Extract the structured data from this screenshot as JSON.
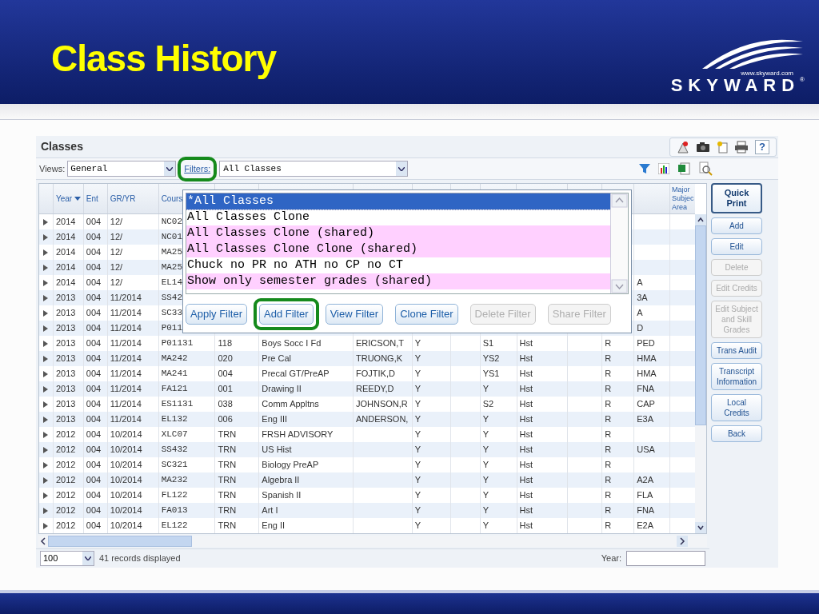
{
  "slide": {
    "title": "Class History",
    "logo": {
      "url": "www.skyward.com",
      "name": "SKYWARD",
      "mark": "®"
    }
  },
  "panel": {
    "title": "Classes",
    "help_label": "?"
  },
  "toolbar": {
    "views_label": "Views:",
    "views_value": "General",
    "filters_link": "Filters:",
    "filters_highlighted": true,
    "filter_value": "All Classes"
  },
  "table": {
    "columns": [
      {
        "label": "Year",
        "sorted": true
      },
      {
        "label": "Ent",
        "sorted": false
      },
      {
        "label": "GR/YR",
        "sorted": false
      },
      {
        "label": "Cours",
        "sorted": false
      }
    ],
    "last_column_heading": [
      "Major",
      "Subjec",
      "Area"
    ],
    "rows": [
      {
        "year": "2014",
        "ent": "004",
        "gr_yr": "12/",
        "course": "NC02"
      },
      {
        "year": "2014",
        "ent": "004",
        "gr_yr": "12/",
        "course": "NC01"
      },
      {
        "year": "2014",
        "ent": "004",
        "gr_yr": "12/",
        "course": "MA25"
      },
      {
        "year": "2014",
        "ent": "004",
        "gr_yr": "12/",
        "course": "MA25"
      },
      {
        "year": "2014",
        "ent": "004",
        "gr_yr": "12/",
        "course": "EL14",
        "column_14": "A"
      },
      {
        "year": "2013",
        "ent": "004",
        "gr_yr": "11/2014",
        "course": "SS42",
        "column_14": "3A"
      },
      {
        "year": "2013",
        "ent": "004",
        "gr_yr": "11/2014",
        "course": "SC33",
        "column_14": "A"
      },
      {
        "year": "2013",
        "ent": "004",
        "gr_yr": "11/2014",
        "course": "P011",
        "column_14": "D"
      },
      {
        "year": "2013",
        "ent": "004",
        "gr_yr": "11/2014",
        "course": "P01131",
        "section": "118",
        "description": "Boys Socc I Fd",
        "teacher": "ERICSON,T",
        "column_8": "Y",
        "column_10": "S1",
        "column_11": "Hst",
        "column_13": "R",
        "column_14": "PED"
      },
      {
        "year": "2013",
        "ent": "004",
        "gr_yr": "11/2014",
        "course": "MA242",
        "section": "020",
        "description": "Pre Cal",
        "teacher": "TRUONG,K",
        "column_8": "Y",
        "column_10": "YS2",
        "column_11": "Hst",
        "column_13": "R",
        "column_14": "HMA"
      },
      {
        "year": "2013",
        "ent": "004",
        "gr_yr": "11/2014",
        "course": "MA241",
        "section": "004",
        "description": "Precal GT/PreAP",
        "teacher": "FOJTIK,D",
        "column_8": "Y",
        "column_10": "YS1",
        "column_11": "Hst",
        "column_13": "R",
        "column_14": "HMA"
      },
      {
        "year": "2013",
        "ent": "004",
        "gr_yr": "11/2014",
        "course": "FA121",
        "section": "001",
        "description": "Drawing II",
        "teacher": "REEDY,D",
        "column_8": "Y",
        "column_10": "Y",
        "column_11": "Hst",
        "column_13": "R",
        "column_14": "FNA"
      },
      {
        "year": "2013",
        "ent": "004",
        "gr_yr": "11/2014",
        "course": "ES1131",
        "section": "038",
        "description": "Comm Appltns",
        "teacher": "JOHNSON,R",
        "column_8": "Y",
        "column_10": "S2",
        "column_11": "Hst",
        "column_13": "R",
        "column_14": "CAP"
      },
      {
        "year": "2013",
        "ent": "004",
        "gr_yr": "11/2014",
        "course": "EL132",
        "section": "006",
        "description": "Eng III",
        "teacher": "ANDERSON,",
        "column_8": "Y",
        "column_10": "Y",
        "column_11": "Hst",
        "column_13": "R",
        "column_14": "E3A"
      },
      {
        "year": "2012",
        "ent": "004",
        "gr_yr": "10/2014",
        "course": "XLC07",
        "section": "TRN",
        "description": "FRSH ADVISORY",
        "column_8": "Y",
        "column_10": "Y",
        "column_11": "Hst",
        "column_13": "R"
      },
      {
        "year": "2012",
        "ent": "004",
        "gr_yr": "10/2014",
        "course": "SS432",
        "section": "TRN",
        "description": "US Hist",
        "column_8": "Y",
        "column_10": "Y",
        "column_11": "Hst",
        "column_13": "R",
        "column_14": "USA"
      },
      {
        "year": "2012",
        "ent": "004",
        "gr_yr": "10/2014",
        "course": "SC321",
        "section": "TRN",
        "description": "Biology PreAP",
        "column_8": "Y",
        "column_10": "Y",
        "column_11": "Hst",
        "column_13": "R"
      },
      {
        "year": "2012",
        "ent": "004",
        "gr_yr": "10/2014",
        "course": "MA232",
        "section": "TRN",
        "description": "Algebra II",
        "column_8": "Y",
        "column_10": "Y",
        "column_11": "Hst",
        "column_13": "R",
        "column_14": "A2A"
      },
      {
        "year": "2012",
        "ent": "004",
        "gr_yr": "10/2014",
        "course": "FL122",
        "section": "TRN",
        "description": "Spanish II",
        "column_8": "Y",
        "column_10": "Y",
        "column_11": "Hst",
        "column_13": "R",
        "column_14": "FLA"
      },
      {
        "year": "2012",
        "ent": "004",
        "gr_yr": "10/2014",
        "course": "FA013",
        "section": "TRN",
        "description": "Art I",
        "column_8": "Y",
        "column_10": "Y",
        "column_11": "Hst",
        "column_13": "R",
        "column_14": "FNA"
      },
      {
        "year": "2012",
        "ent": "004",
        "gr_yr": "10/2014",
        "course": "EL122",
        "section": "TRN",
        "description": "Eng II",
        "column_8": "Y",
        "column_10": "Y",
        "column_11": "Hst",
        "column_13": "R",
        "column_14": "E2A"
      }
    ]
  },
  "filter_menu": {
    "items": [
      {
        "label": "*All Classes",
        "selected": true,
        "shared": false
      },
      {
        "label": "All Classes Clone",
        "selected": false,
        "shared": false
      },
      {
        "label": "All Classes Clone (shared)",
        "selected": false,
        "shared": true
      },
      {
        "label": "All Classes Clone Clone (shared)",
        "selected": false,
        "shared": true
      },
      {
        "label": "Chuck no PR no ATH no CP no CT",
        "selected": false,
        "shared": false
      },
      {
        "label": "Show only semester grades (shared)",
        "selected": false,
        "shared": true
      }
    ],
    "buttons": [
      {
        "label": "Apply Filter",
        "disabled": false,
        "highlighted": false
      },
      {
        "label": "Add Filter",
        "disabled": false,
        "highlighted": true
      },
      {
        "label": "View Filter",
        "disabled": false,
        "highlighted": false
      },
      {
        "label": "Clone Filter",
        "disabled": false,
        "highlighted": false
      },
      {
        "label": "Delete Filter",
        "disabled": true,
        "highlighted": false
      },
      {
        "label": "Share Filter",
        "disabled": true,
        "highlighted": false
      }
    ]
  },
  "side_buttons": [
    {
      "label": "Quick Print",
      "kind": "primary",
      "disabled": false
    },
    {
      "label": "Add",
      "kind": "normal",
      "disabled": false
    },
    {
      "label": "Edit",
      "kind": "normal",
      "disabled": false
    },
    {
      "label": "Delete",
      "kind": "normal",
      "disabled": true
    },
    {
      "label": "Edit Credits",
      "kind": "normal",
      "disabled": true
    },
    {
      "label": "Edit Subject and Skill Grades",
      "kind": "normal",
      "disabled": true
    },
    {
      "label": "Trans Audit",
      "kind": "normal",
      "disabled": false
    },
    {
      "label": "Transcript Information",
      "kind": "normal",
      "disabled": false
    },
    {
      "label": "Local Credits",
      "kind": "normal",
      "disabled": false
    },
    {
      "label": "Back",
      "kind": "normal",
      "disabled": false
    }
  ],
  "footer": {
    "page_size": "100",
    "records": "41 records displayed",
    "year_label": "Year:"
  }
}
